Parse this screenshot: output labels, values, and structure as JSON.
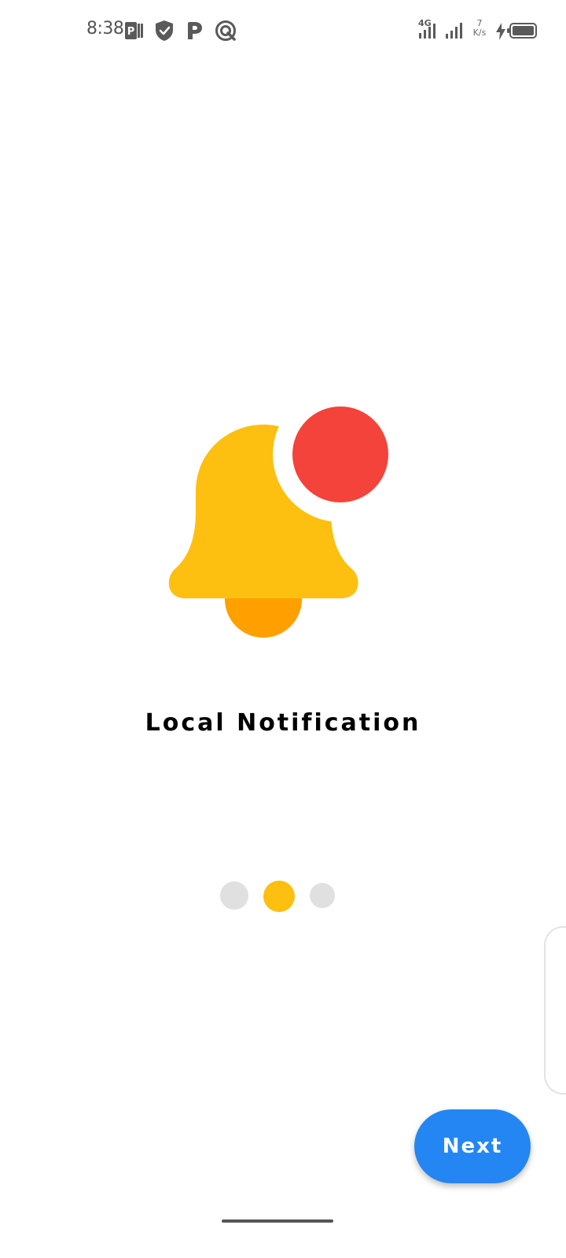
{
  "status_bar": {
    "time": "8:38",
    "left_icons": [
      "parking-app-icon",
      "shield-check-icon",
      "p-icon",
      "q-circle-icon"
    ],
    "network_type": "4G",
    "speed_value": "7",
    "speed_unit": "K/s",
    "right_icons": [
      "signal-icon",
      "signal-icon",
      "charging-icon",
      "battery-icon"
    ]
  },
  "illustration": {
    "icon": "notification-bell-icon",
    "colors": {
      "bell": "#fdc011",
      "clapper": "#ff9f00",
      "badge": "#f4433a"
    }
  },
  "onboarding": {
    "title": "Local Notification",
    "page_count": 3,
    "current_page": 2,
    "active_dot_color": "#fdc011",
    "inactive_dot_color": "#e0e0e0"
  },
  "actions": {
    "next_label": "Next",
    "next_color": "#2486f2"
  }
}
